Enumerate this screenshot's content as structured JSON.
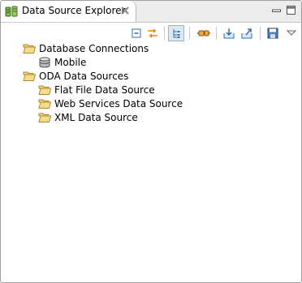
{
  "view": {
    "title": "Data Source Explorer",
    "tab_icon": "data-source-explorer-icon",
    "close_icon": "close-icon",
    "minimize_icon": "minimize-icon",
    "maximize_icon": "maximize-icon"
  },
  "toolbar": {
    "buttons": [
      {
        "name": "collapse-all-button",
        "icon": "collapse-all-icon"
      },
      {
        "name": "link-with-editor-button",
        "icon": "link-with-editor-icon"
      },
      {
        "name": "show-tree-button",
        "icon": "tree-view-icon",
        "pressed": true
      },
      {
        "name": "connect-button",
        "icon": "connect-plug-icon"
      },
      {
        "name": "import-button",
        "icon": "import-icon"
      },
      {
        "name": "export-button",
        "icon": "export-icon"
      },
      {
        "name": "save-button",
        "icon": "save-icon"
      },
      {
        "name": "view-menu-button",
        "icon": "view-menu-icon"
      }
    ]
  },
  "tree": {
    "nodes": [
      {
        "label": "Database Connections",
        "icon": "folder-open-icon"
      },
      {
        "label": "Mobile",
        "icon": "database-icon"
      },
      {
        "label": "ODA Data Sources",
        "icon": "folder-open-icon"
      },
      {
        "label": "Flat File Data Source",
        "icon": "folder-open-icon"
      },
      {
        "label": "Web Services Data Source",
        "icon": "folder-open-icon"
      },
      {
        "label": "XML Data Source",
        "icon": "folder-open-icon"
      }
    ]
  },
  "colors": {
    "folder_fill": "#f2d47a",
    "folder_stroke": "#b08a2e",
    "accent_blue": "#2f6fb0",
    "accent_orange": "#e08a1a"
  }
}
